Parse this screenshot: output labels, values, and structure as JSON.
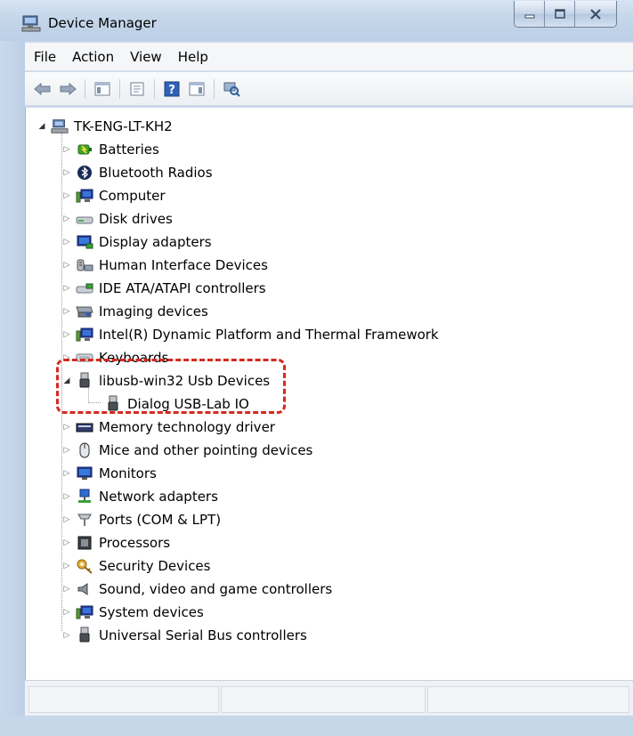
{
  "window": {
    "title": "Device Manager",
    "controls": [
      "minimize",
      "maximize",
      "close"
    ]
  },
  "menu": {
    "items": [
      "File",
      "Action",
      "View",
      "Help"
    ]
  },
  "toolbar": {
    "buttons": [
      "back-arrow-icon",
      "forward-arrow-icon",
      "show-hide-console-tree-icon",
      "properties-icon",
      "help-icon",
      "show-action-pane-icon",
      "scan-hardware-icon"
    ]
  },
  "tree": {
    "root": "TK-ENG-LT-KH2",
    "categories": [
      {
        "label": "Batteries",
        "icon": "battery-icon",
        "expanded": false
      },
      {
        "label": "Bluetooth Radios",
        "icon": "bluetooth-icon",
        "expanded": false
      },
      {
        "label": "Computer",
        "icon": "computer-icon",
        "expanded": false
      },
      {
        "label": "Disk drives",
        "icon": "disk-drive-icon",
        "expanded": false
      },
      {
        "label": "Display adapters",
        "icon": "display-adapter-icon",
        "expanded": false
      },
      {
        "label": "Human Interface Devices",
        "icon": "hid-icon",
        "expanded": false
      },
      {
        "label": "IDE ATA/ATAPI controllers",
        "icon": "ide-controller-icon",
        "expanded": false
      },
      {
        "label": "Imaging devices",
        "icon": "camera-icon",
        "expanded": false
      },
      {
        "label": "Intel(R) Dynamic Platform and Thermal Framework",
        "icon": "computer-icon",
        "expanded": false
      },
      {
        "label": "Keyboards",
        "icon": "keyboard-icon",
        "expanded": false
      },
      {
        "label": "libusb-win32 Usb Devices",
        "icon": "usb-icon",
        "expanded": true,
        "children": [
          {
            "label": "Dialog USB-Lab IO",
            "icon": "usb-icon"
          }
        ]
      },
      {
        "label": "Memory technology driver",
        "icon": "memory-icon",
        "expanded": false
      },
      {
        "label": "Mice and other pointing devices",
        "icon": "mouse-icon",
        "expanded": false
      },
      {
        "label": "Monitors",
        "icon": "monitor-icon",
        "expanded": false
      },
      {
        "label": "Network adapters",
        "icon": "network-icon",
        "expanded": false
      },
      {
        "label": "Ports (COM & LPT)",
        "icon": "port-icon",
        "expanded": false
      },
      {
        "label": "Processors",
        "icon": "processor-icon",
        "expanded": false
      },
      {
        "label": "Security Devices",
        "icon": "key-icon",
        "expanded": false
      },
      {
        "label": "Sound, video and game controllers",
        "icon": "speaker-icon",
        "expanded": false
      },
      {
        "label": "System devices",
        "icon": "computer-icon",
        "expanded": false
      },
      {
        "label": "Universal Serial Bus controllers",
        "icon": "usb-icon",
        "expanded": false
      }
    ]
  },
  "annotation": {
    "highlight_color": "#d42a1f"
  },
  "colors": {
    "frame": "#c9d9ec",
    "tree_background": "#ffffff"
  }
}
